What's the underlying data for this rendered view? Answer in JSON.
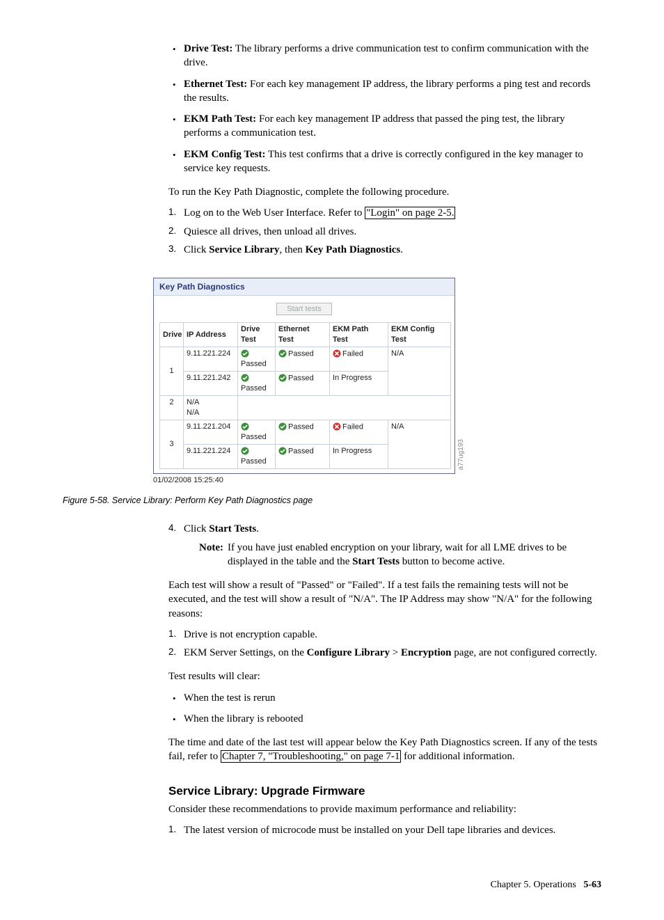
{
  "bullets_top": [
    {
      "term": "Drive Test:",
      "text": " The library performs a drive communication test to confirm communication with the drive."
    },
    {
      "term": "Ethernet Test:",
      "text": " For each key management IP address, the library performs a ping test and records the results."
    },
    {
      "term": "EKM Path Test:",
      "text": " For each key management IP address that passed the ping test, the library performs a communication test."
    },
    {
      "term": "EKM Config Test:",
      "text": " This test confirms that a drive is correctly configured in the key manager to service key requests."
    }
  ],
  "p_run": "To run the Key Path Diagnostic, complete the following procedure.",
  "steps_top": {
    "s1_pre": "Log on to the Web User Interface. Refer to ",
    "s1_link": "\"Login\" on page 2-5.",
    "s2": "Quiesce all drives, then unload all drives.",
    "s3_pre": "Click ",
    "s3_b1": "Service Library",
    "s3_mid": ", then ",
    "s3_b2": "Key Path Diagnostics",
    "s3_post": "."
  },
  "figure": {
    "title": "Key Path Diagnostics",
    "button": "Start tests",
    "headers": {
      "drive": "Drive",
      "ip": "IP Address",
      "drive_test": "Drive Test",
      "eth": "Ethernet Test",
      "path": "EKM Path Test",
      "cfg": "EKM Config Test"
    },
    "rows": [
      {
        "drive": "1",
        "sub": [
          {
            "ip": "9.11.221.224",
            "drive_test": "Passed",
            "eth": "Passed",
            "path": "Failed",
            "cfg": "N/A"
          },
          {
            "ip": "9.11.221.242",
            "drive_test": "Passed",
            "eth": "Passed",
            "path": "In Progress",
            "cfg": ""
          }
        ]
      },
      {
        "drive": "2",
        "na": true,
        "na1": "N/A",
        "na2": "N/A"
      },
      {
        "drive": "3",
        "sub": [
          {
            "ip": "9.11.221.204",
            "drive_test": "Passed",
            "eth": "Passed",
            "path": "Failed",
            "cfg": "N/A"
          },
          {
            "ip": "9.11.221.224",
            "drive_test": "Passed",
            "eth": "Passed",
            "path": "In Progress",
            "cfg": ""
          }
        ]
      }
    ],
    "timestamp": "01/02/2008 15:25:40",
    "sidecode": "a77ug193"
  },
  "caption": "Figure 5-58. Service Library: Perform Key Path Diagnostics page",
  "step4": {
    "pre": "Click ",
    "b": "Start Tests",
    "post": "."
  },
  "note": {
    "label": "Note:",
    "pre": "If you have just enabled encryption on your library, wait for all LME drives to be displayed in the table and the ",
    "b": "Start Tests",
    "post": " button to become active."
  },
  "p_each": "Each test will show a result of \"Passed\" or \"Failed\". If a test fails the remaining tests will not be executed, and the test will show a result of \"N/A\". The IP Address may show \"N/A\" for the following reasons:",
  "reasons": {
    "r1": "Drive is not encryption capable.",
    "r2_pre": "EKM Server Settings, on the ",
    "r2_b1": "Configure Library",
    "r2_mid": " > ",
    "r2_b2": "Encryption",
    "r2_post": " page, are not configured correctly."
  },
  "p_clear": "Test results will clear:",
  "clear_list": [
    "When the test is rerun",
    "When the library is rebooted"
  ],
  "p_time_pre": "The time and date of the last test will appear below the Key Path Diagnostics screen. If any of the tests fail, refer to ",
  "p_time_link": "Chapter 7, \"Troubleshooting,\" on page 7-1",
  "p_time_post": " for additional information.",
  "sect_title": "Service Library: Upgrade Firmware",
  "p_consider": "Consider these recommendations to provide maximum performance and reliability:",
  "rec1": "The latest version of microcode must be installed on your Dell tape libraries and devices.",
  "footer": {
    "chapter": "Chapter 5. Operations",
    "page": "5-63"
  }
}
